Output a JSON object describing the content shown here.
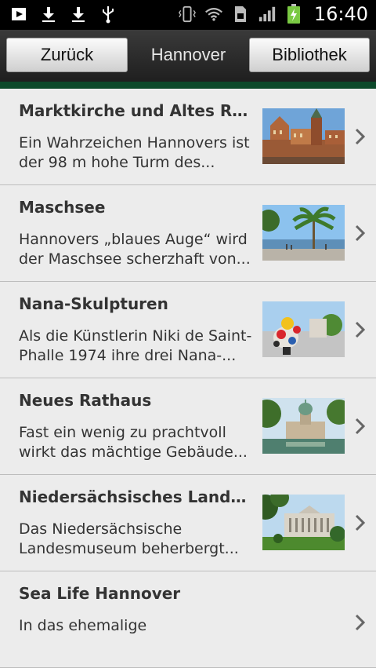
{
  "status_bar": {
    "time": "16:40",
    "left_icons": [
      "play-store-icon",
      "download-icon",
      "download-icon",
      "usb-icon"
    ],
    "right_icons": [
      "vibrate-icon",
      "wifi-icon",
      "sim-icon",
      "signal-icon",
      "battery-charging-icon"
    ]
  },
  "header": {
    "back_label": "Zurück",
    "title": "Hannover",
    "library_label": "Bibliothek"
  },
  "items": [
    {
      "title": "Marktkirche und Altes Rath...",
      "desc_line1": "Ein Wahrzeichen Hannovers ist",
      "desc_line2": "der 98 m hohe Turm des..."
    },
    {
      "title": "Maschsee",
      "desc_line1": "Hannovers „blaues Auge“ wird",
      "desc_line2": "der Maschsee scherzhaft von..."
    },
    {
      "title": "Nana-Skulpturen",
      "desc_line1": "Als die Künstlerin Niki de Saint-",
      "desc_line2": "Phalle 1974 ihre drei Nana-..."
    },
    {
      "title": "Neues Rathaus",
      "desc_line1": "Fast ein wenig zu prachtvoll",
      "desc_line2": "wirkt das mächtige Gebäude..."
    },
    {
      "title": "Niedersächsisches Landes...",
      "desc_line1": "Das Niedersächsische",
      "desc_line2": "Landesmuseum beherbergt..."
    },
    {
      "title": "Sea Life Hannover",
      "desc_line1": "In das ehemalige",
      "desc_line2": ""
    }
  ]
}
